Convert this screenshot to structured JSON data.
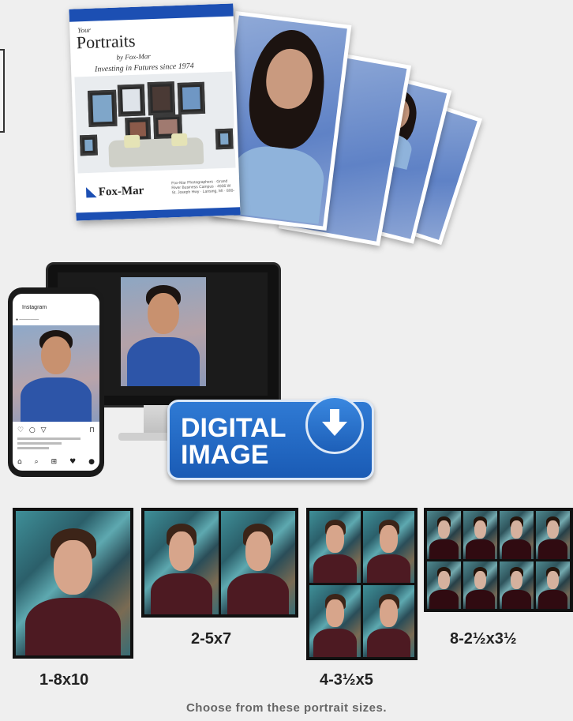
{
  "brochure": {
    "your": "Your",
    "portraits": "Portraits",
    "by": "by Fox-Mar",
    "tagline": "Investing in Futures since 1974",
    "logo": "Fox-Mar",
    "address": "Fox-Mar Photographers · Grand River Business Campus · 4936 W St. Joseph Hwy · Lansing, MI · 800-"
  },
  "instagram": {
    "app": "Instagram",
    "icons": "♡ ○ ▽",
    "save_icon": "⊓",
    "nav": [
      "⌂",
      "⌕",
      "⊞",
      "♥",
      "●"
    ]
  },
  "digital_badge": {
    "line1": "DIGITAL",
    "line2": "IMAGE"
  },
  "packages": [
    {
      "label": "1-8x10"
    },
    {
      "label": "2-5x7"
    },
    {
      "label": "4-3½x5"
    },
    {
      "label": "8-2½x3½"
    }
  ],
  "caption": "Choose from these portrait sizes."
}
